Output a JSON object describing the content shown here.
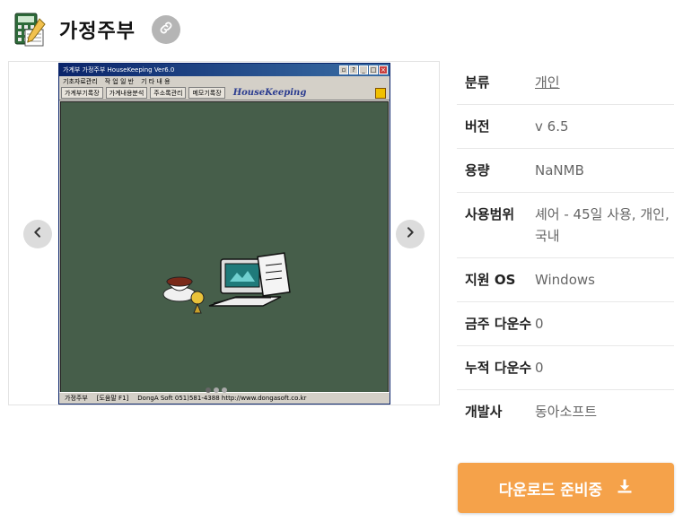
{
  "header": {
    "title": "가정주부",
    "app_icon": "calculator-pencil-icon",
    "share_icon": "link-icon"
  },
  "gallery": {
    "prev_icon": "chevron-left-icon",
    "next_icon": "chevron-right-icon",
    "slide_count": 3,
    "active_slide": 1,
    "screenshot": {
      "window_title": "가계부 가정주부 HouseKeeping Ver6.0",
      "menu": [
        "기초자료관리",
        "작 업 일 반",
        "기 타 내 용"
      ],
      "toolbar": [
        "가계부기록장",
        "가계내용분석",
        "주소록관리",
        "메모기록장"
      ],
      "brand": "HouseKeeping",
      "status": [
        "가정주부",
        "[도움말 F1]",
        "DongA Soft 051)581-4388 http://www.dongasoft.co.kr"
      ],
      "canvas_color": "#465e4a"
    }
  },
  "info": {
    "rows": [
      {
        "label": "분류",
        "value": "개인",
        "link": true
      },
      {
        "label": "버전",
        "value": "v 6.5"
      },
      {
        "label": "용량",
        "value": "NaNMB"
      },
      {
        "label": "사용범위",
        "value": "셰어 - 45일 사용, 개인, 국내"
      },
      {
        "label": "지원 OS",
        "value": "Windows"
      },
      {
        "label": "금주 다운수",
        "value": "0"
      },
      {
        "label": "누적 다운수",
        "value": "0"
      },
      {
        "label": "개발사",
        "value": "동아소프트"
      }
    ]
  },
  "download": {
    "label": "다운로드 준비중",
    "icon": "download-icon",
    "color": "#f5a24a"
  }
}
